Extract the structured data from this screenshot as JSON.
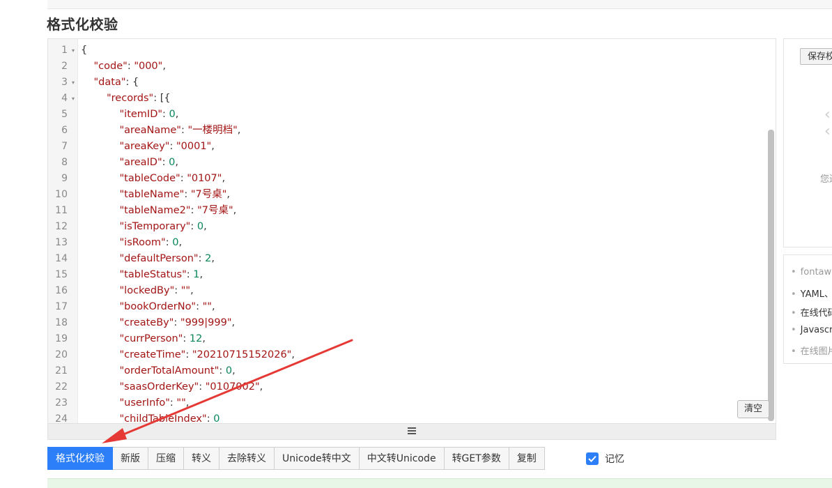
{
  "page": {
    "title": "格式化校验"
  },
  "editor": {
    "lines": [
      {
        "n": "1",
        "fold": true,
        "indent": 0,
        "tokens": [
          [
            "p",
            "{"
          ]
        ]
      },
      {
        "n": "2",
        "fold": false,
        "indent": 1,
        "tokens": [
          [
            "k",
            "\"code\""
          ],
          [
            "p",
            ": "
          ],
          [
            "s",
            "\"000\""
          ],
          [
            "p",
            ","
          ]
        ]
      },
      {
        "n": "3",
        "fold": true,
        "indent": 1,
        "tokens": [
          [
            "k",
            "\"data\""
          ],
          [
            "p",
            ": {"
          ]
        ]
      },
      {
        "n": "4",
        "fold": true,
        "indent": 2,
        "tokens": [
          [
            "k",
            "\"records\""
          ],
          [
            "p",
            ": [{"
          ]
        ]
      },
      {
        "n": "5",
        "fold": false,
        "indent": 3,
        "tokens": [
          [
            "k",
            "\"itemID\""
          ],
          [
            "p",
            ": "
          ],
          [
            "n",
            "0"
          ],
          [
            "p",
            ","
          ]
        ]
      },
      {
        "n": "6",
        "fold": false,
        "indent": 3,
        "tokens": [
          [
            "k",
            "\"areaName\""
          ],
          [
            "p",
            ": "
          ],
          [
            "s",
            "\"一楼明档\""
          ],
          [
            "p",
            ","
          ]
        ]
      },
      {
        "n": "7",
        "fold": false,
        "indent": 3,
        "tokens": [
          [
            "k",
            "\"areaKey\""
          ],
          [
            "p",
            ": "
          ],
          [
            "s",
            "\"0001\""
          ],
          [
            "p",
            ","
          ]
        ]
      },
      {
        "n": "8",
        "fold": false,
        "indent": 3,
        "tokens": [
          [
            "k",
            "\"areaID\""
          ],
          [
            "p",
            ": "
          ],
          [
            "n",
            "0"
          ],
          [
            "p",
            ","
          ]
        ]
      },
      {
        "n": "9",
        "fold": false,
        "indent": 3,
        "tokens": [
          [
            "k",
            "\"tableCode\""
          ],
          [
            "p",
            ": "
          ],
          [
            "s",
            "\"0107\""
          ],
          [
            "p",
            ","
          ]
        ]
      },
      {
        "n": "10",
        "fold": false,
        "indent": 3,
        "tokens": [
          [
            "k",
            "\"tableName\""
          ],
          [
            "p",
            ": "
          ],
          [
            "s",
            "\"7号桌\""
          ],
          [
            "p",
            ","
          ]
        ]
      },
      {
        "n": "11",
        "fold": false,
        "indent": 3,
        "tokens": [
          [
            "k",
            "\"tableName2\""
          ],
          [
            "p",
            ": "
          ],
          [
            "s",
            "\"7号桌\""
          ],
          [
            "p",
            ","
          ]
        ]
      },
      {
        "n": "12",
        "fold": false,
        "indent": 3,
        "tokens": [
          [
            "k",
            "\"isTemporary\""
          ],
          [
            "p",
            ": "
          ],
          [
            "n",
            "0"
          ],
          [
            "p",
            ","
          ]
        ]
      },
      {
        "n": "13",
        "fold": false,
        "indent": 3,
        "tokens": [
          [
            "k",
            "\"isRoom\""
          ],
          [
            "p",
            ": "
          ],
          [
            "n",
            "0"
          ],
          [
            "p",
            ","
          ]
        ]
      },
      {
        "n": "14",
        "fold": false,
        "indent": 3,
        "tokens": [
          [
            "k",
            "\"defaultPerson\""
          ],
          [
            "p",
            ": "
          ],
          [
            "n",
            "2"
          ],
          [
            "p",
            ","
          ]
        ]
      },
      {
        "n": "15",
        "fold": false,
        "indent": 3,
        "tokens": [
          [
            "k",
            "\"tableStatus\""
          ],
          [
            "p",
            ": "
          ],
          [
            "n",
            "1"
          ],
          [
            "p",
            ","
          ]
        ]
      },
      {
        "n": "16",
        "fold": false,
        "indent": 3,
        "tokens": [
          [
            "k",
            "\"lockedBy\""
          ],
          [
            "p",
            ": "
          ],
          [
            "s",
            "\"\""
          ],
          [
            "p",
            ","
          ]
        ]
      },
      {
        "n": "17",
        "fold": false,
        "indent": 3,
        "tokens": [
          [
            "k",
            "\"bookOrderNo\""
          ],
          [
            "p",
            ": "
          ],
          [
            "s",
            "\"\""
          ],
          [
            "p",
            ","
          ]
        ]
      },
      {
        "n": "18",
        "fold": false,
        "indent": 3,
        "tokens": [
          [
            "k",
            "\"createBy\""
          ],
          [
            "p",
            ": "
          ],
          [
            "s",
            "\"999|999\""
          ],
          [
            "p",
            ","
          ]
        ]
      },
      {
        "n": "19",
        "fold": false,
        "indent": 3,
        "tokens": [
          [
            "k",
            "\"currPerson\""
          ],
          [
            "p",
            ": "
          ],
          [
            "n",
            "12"
          ],
          [
            "p",
            ","
          ]
        ]
      },
      {
        "n": "20",
        "fold": false,
        "indent": 3,
        "tokens": [
          [
            "k",
            "\"createTime\""
          ],
          [
            "p",
            ": "
          ],
          [
            "s",
            "\"20210715152026\""
          ],
          [
            "p",
            ","
          ]
        ]
      },
      {
        "n": "21",
        "fold": false,
        "indent": 3,
        "tokens": [
          [
            "k",
            "\"orderTotalAmount\""
          ],
          [
            "p",
            ": "
          ],
          [
            "n",
            "0"
          ],
          [
            "p",
            ","
          ]
        ]
      },
      {
        "n": "22",
        "fold": false,
        "indent": 3,
        "tokens": [
          [
            "k",
            "\"saasOrderKey\""
          ],
          [
            "p",
            ": "
          ],
          [
            "s",
            "\"0107002\""
          ],
          [
            "p",
            ","
          ]
        ]
      },
      {
        "n": "23",
        "fold": false,
        "indent": 3,
        "tokens": [
          [
            "k",
            "\"userInfo\""
          ],
          [
            "p",
            ": "
          ],
          [
            "s",
            "\"\""
          ],
          [
            "p",
            ","
          ]
        ]
      },
      {
        "n": "24",
        "fold": false,
        "indent": 3,
        "tokens": [
          [
            "k",
            "\"childTableIndex\""
          ],
          [
            "p",
            ": "
          ],
          [
            "n",
            "0"
          ]
        ]
      }
    ],
    "clear_label": "清空",
    "resize_icon": "hamburger-icon"
  },
  "toolbar": {
    "buttons": [
      {
        "label": "格式化校验",
        "active": true
      },
      {
        "label": "新版",
        "active": false
      },
      {
        "label": "压缩",
        "active": false
      },
      {
        "label": "转义",
        "active": false
      },
      {
        "label": "去除转义",
        "active": false
      },
      {
        "label": "Unicode转中文",
        "active": false
      },
      {
        "label": "中文转Unicode",
        "active": false
      },
      {
        "label": "转GET参数",
        "active": false
      },
      {
        "label": "复制",
        "active": false
      }
    ],
    "remember": {
      "label": "记忆",
      "checked": true
    }
  },
  "side": {
    "save_label": "保存校",
    "hint": "您还",
    "links": [
      {
        "text": "fontawe",
        "muted": true
      },
      {
        "text": "YAML、",
        "muted": false
      },
      {
        "text": "在线代码",
        "muted": false
      },
      {
        "text": "Javascr",
        "muted": false
      },
      {
        "text": "在线图片",
        "muted": true
      }
    ]
  },
  "colors": {
    "accent": "#2d7ff9",
    "json_key": "#a31515",
    "json_string": "#a31515",
    "json_number": "#098658",
    "annotation_arrow": "#e53935"
  }
}
